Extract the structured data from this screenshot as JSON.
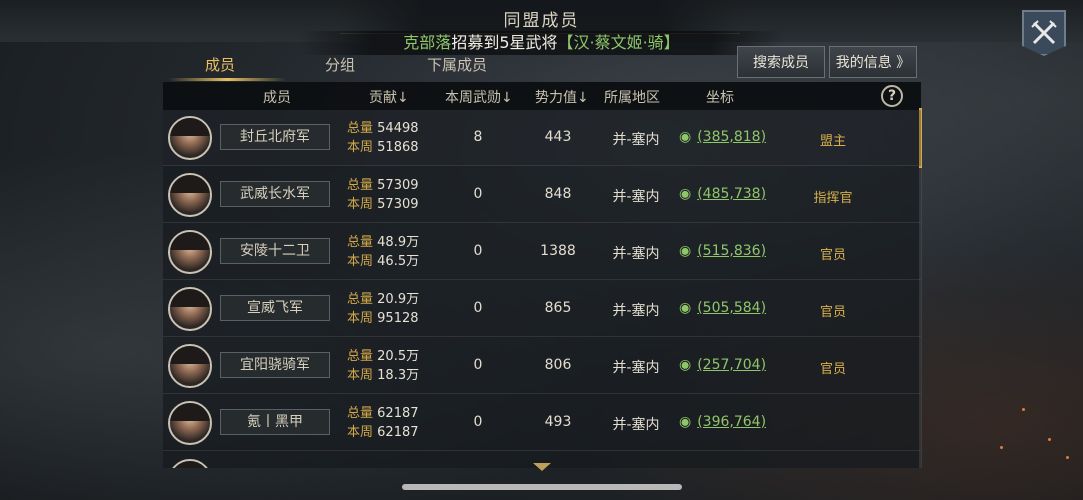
{
  "title": "同盟成员",
  "marquee": {
    "name": "克部落",
    "mid": "招募到5星武将",
    "hero": "【汉·蔡文姬·骑】"
  },
  "tabs": [
    {
      "label": "成员",
      "active": true
    },
    {
      "label": "分组",
      "active": false
    },
    {
      "label": "下属成员",
      "active": false
    }
  ],
  "buttons": {
    "search": "搜索成员",
    "my_info": "我的信息 》"
  },
  "columns": {
    "member": "成员",
    "contribution": "贡献↓",
    "weekly_merit": "本周武勋↓",
    "power": "势力值↓",
    "region": "所属地区",
    "coords": "坐标",
    "help": "?"
  },
  "contrib_labels": {
    "total": "总量",
    "week": "本周"
  },
  "members": [
    {
      "name": "封丘北府军",
      "total": "54498",
      "week": "51868",
      "merit": "8",
      "power": "443",
      "region": "并-塞内",
      "coords": "(385,818)",
      "role": "盟主"
    },
    {
      "name": "武威长水军",
      "total": "57309",
      "week": "57309",
      "merit": "0",
      "power": "848",
      "region": "并-塞内",
      "coords": "(485,738)",
      "role": "指挥官"
    },
    {
      "name": "安陵十二卫",
      "total": "48.9万",
      "week": "46.5万",
      "merit": "0",
      "power": "1388",
      "region": "并-塞内",
      "coords": "(515,836)",
      "role": "官员"
    },
    {
      "name": "宣威飞军",
      "total": "20.9万",
      "week": "95128",
      "merit": "0",
      "power": "865",
      "region": "并-塞内",
      "coords": "(505,584)",
      "role": "官员"
    },
    {
      "name": "宜阳骁骑军",
      "total": "20.5万",
      "week": "18.3万",
      "merit": "0",
      "power": "806",
      "region": "并-塞内",
      "coords": "(257,704)",
      "role": "官员"
    },
    {
      "name": "氪丨黑甲",
      "total": "62187",
      "week": "62187",
      "merit": "0",
      "power": "493",
      "region": "并-塞内",
      "coords": "(396,764)",
      "role": ""
    }
  ]
}
